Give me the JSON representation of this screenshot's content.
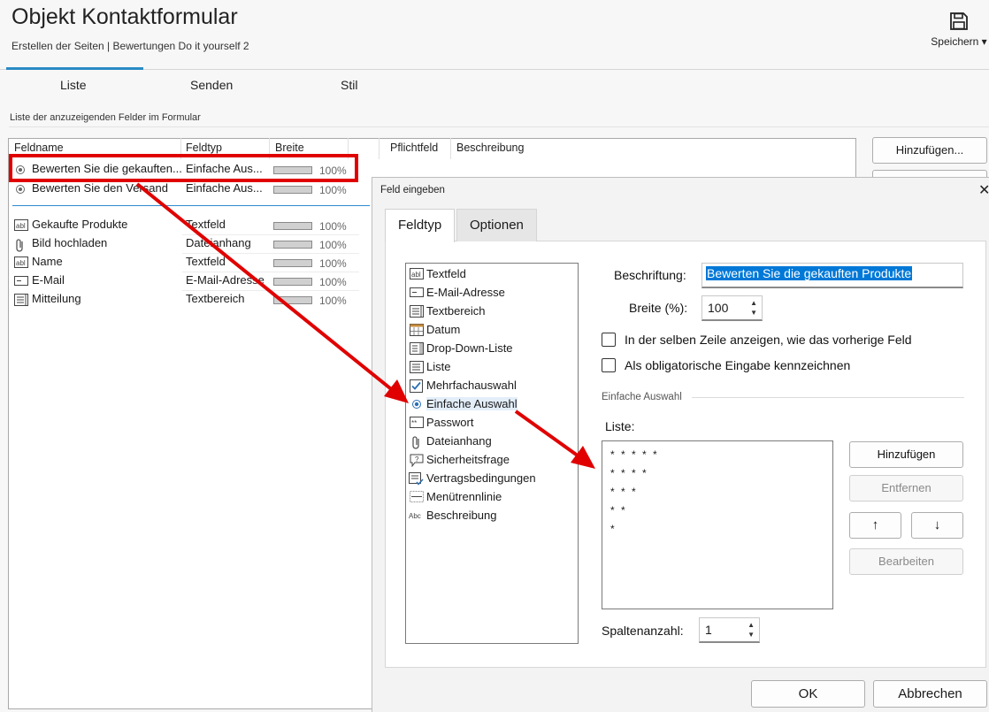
{
  "header": {
    "title": "Objekt Kontaktformular",
    "breadcrumb": "Erstellen der Seiten | Bewertungen Do it yourself 2",
    "save_label": "Speichern ▾",
    "save_icon": "save-icon"
  },
  "main_tabs": [
    {
      "label": "Liste"
    },
    {
      "label": "Senden"
    },
    {
      "label": "Stil"
    }
  ],
  "section_label": "Liste der anzuzeigenden Felder im Formular",
  "table": {
    "columns": [
      "Feldname",
      "Feldtyp",
      "Breite",
      "Pflichtfeld",
      "Beschreibung"
    ],
    "rows": [
      {
        "icon": "radio-icon",
        "name": "Bewerten Sie die gekauften...",
        "type": "Einfache Aus...",
        "width": "100%",
        "width_value": 1.0
      },
      {
        "icon": "radio-icon",
        "name": "Bewerten Sie den Versand",
        "type": "Einfache Aus...",
        "width": "100%",
        "width_value": 1.0
      },
      {
        "icon": "textfield-icon",
        "name": "Gekaufte Produkte",
        "type": "Textfeld",
        "width": "100%",
        "width_value": 1.0
      },
      {
        "icon": "paperclip-icon",
        "name": "Bild hochladen",
        "type": "Dateianhang",
        "width": "100%",
        "width_value": 1.0
      },
      {
        "icon": "textfield-icon",
        "name": "Name",
        "type": "Textfeld",
        "width": "100%",
        "width_value": 1.0
      },
      {
        "icon": "email-icon",
        "name": "E-Mail",
        "type": "E-Mail-Adresse",
        "width": "100%",
        "width_value": 1.0
      },
      {
        "icon": "textarea-icon",
        "name": "Mitteilung",
        "type": "Textbereich",
        "width": "100%",
        "width_value": 1.0
      }
    ]
  },
  "side_buttons": {
    "add": "Hinzufügen..."
  },
  "dialog": {
    "title": "Feld eingeben",
    "close": "✕",
    "tabs": [
      {
        "label": "Feldtyp"
      },
      {
        "label": "Optionen"
      }
    ],
    "field_types": [
      {
        "icon": "textfield-icon",
        "label": "Textfeld"
      },
      {
        "icon": "email-icon",
        "label": "E-Mail-Adresse"
      },
      {
        "icon": "textarea-icon",
        "label": "Textbereich"
      },
      {
        "icon": "calendar-icon",
        "label": "Datum"
      },
      {
        "icon": "dropdown-icon",
        "label": "Drop-Down-Liste"
      },
      {
        "icon": "list-icon",
        "label": "Liste"
      },
      {
        "icon": "checkbox-icon",
        "label": "Mehrfachauswahl"
      },
      {
        "icon": "radio-icon",
        "label": "Einfache Auswahl"
      },
      {
        "icon": "password-icon",
        "label": "Passwort"
      },
      {
        "icon": "paperclip-icon",
        "label": "Dateianhang"
      },
      {
        "icon": "security-question-icon",
        "label": "Sicherheitsfrage"
      },
      {
        "icon": "terms-icon",
        "label": "Vertragsbedingungen"
      },
      {
        "icon": "separator-icon",
        "label": "Menütrennlinie"
      },
      {
        "icon": "description-icon",
        "label": "Beschreibung"
      }
    ],
    "selected_type": "Einfache Auswahl",
    "caption_label": "Beschriftung:",
    "caption_value": "Bewerten Sie die gekauften Produkte",
    "width_label": "Breite (%):",
    "width_value": "100",
    "same_row_label": "In der selben Zeile anzeigen, wie das vorherige Feld",
    "required_label": "Als obligatorische Eingabe kennzeichnen",
    "group_label": "Einfache Auswahl",
    "list_label": "Liste:",
    "list_items": [
      "* * * * *",
      "* * * *",
      "* * *",
      "* *",
      "*"
    ],
    "btn_add": "Hinzufügen",
    "btn_remove": "Entfernen",
    "btn_up": "↑",
    "btn_down": "↓",
    "btn_edit": "Bearbeiten",
    "columns_label": "Spaltenanzahl:",
    "columns_value": "1",
    "ok": "OK",
    "cancel": "Abbrechen"
  },
  "colors": {
    "accent": "#2a8ac4",
    "highlight": "#e00000",
    "selection": "#0078d7"
  }
}
